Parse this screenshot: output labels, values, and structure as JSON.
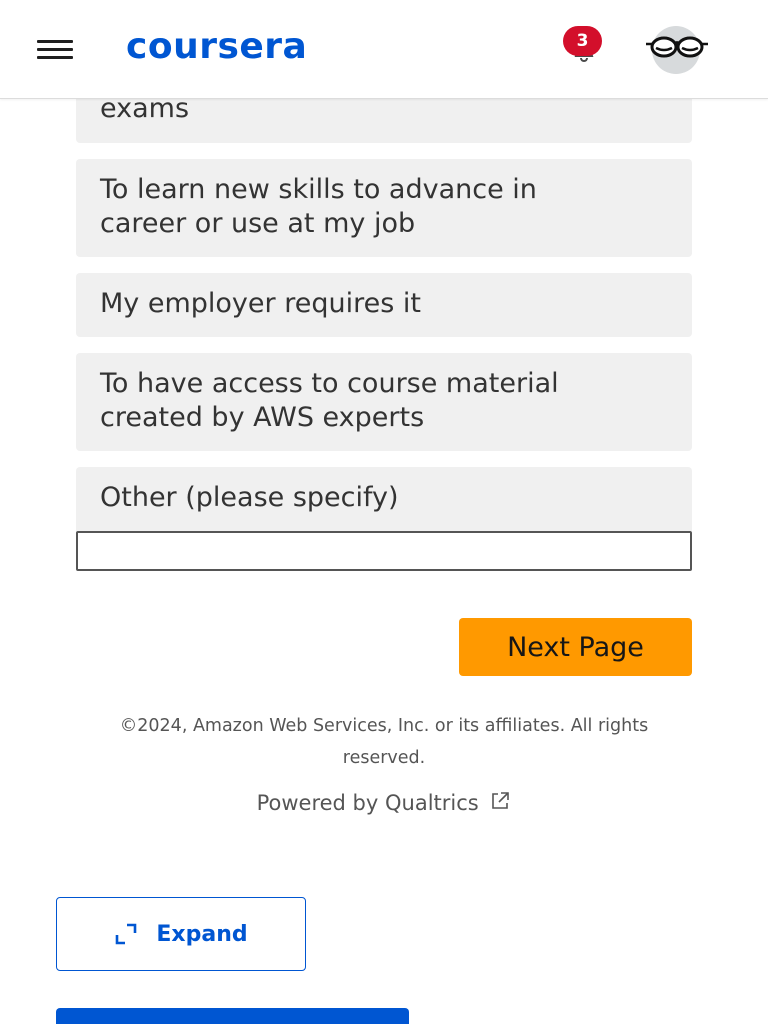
{
  "header": {
    "logo_text": "coursera",
    "notification_count": "3"
  },
  "survey": {
    "options": [
      {
        "label": "exams"
      },
      {
        "label_line1": "To learn new skills to advance in",
        "label_line2": "career or use at my job"
      },
      {
        "label": "My employer requires it"
      },
      {
        "label_line1": "To have access to course material",
        "label_line2": "created by AWS experts"
      },
      {
        "label": "Other (please specify)"
      }
    ],
    "other_value": "",
    "next_button_label": "Next Page"
  },
  "footer": {
    "copyright": "©2024, Amazon Web Services, Inc. or its affiliates. All rights reserved.",
    "powered_by": "Powered by Qualtrics"
  },
  "actions": {
    "expand_label": "Expand"
  },
  "colors": {
    "brand_blue": "#0056d2",
    "next_button_orange": "#ff9900",
    "badge_red": "#d30f2b",
    "option_bg": "#f0f0f0"
  },
  "icons": {
    "menu": "hamburger-menu-icon",
    "notifications": "bell-icon",
    "avatar": "glasses-avatar-icon",
    "external_link": "external-link-icon",
    "expand": "expand-corners-icon"
  }
}
